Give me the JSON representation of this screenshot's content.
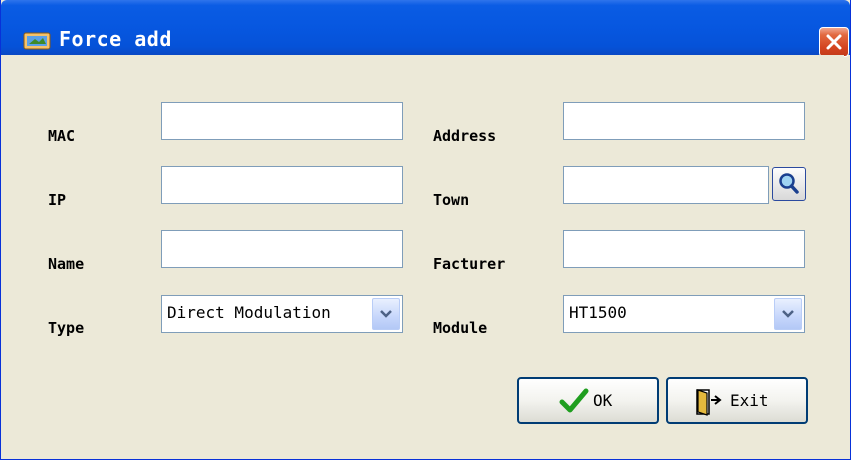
{
  "window": {
    "title": "Force add",
    "close_label": "Close"
  },
  "form": {
    "mac": {
      "label": "MAC",
      "value": ""
    },
    "ip": {
      "label": "IP",
      "value": ""
    },
    "name": {
      "label": "Name",
      "value": ""
    },
    "type": {
      "label": "Type",
      "selected": "Direct Modulation"
    },
    "address": {
      "label": "Address",
      "value": ""
    },
    "town": {
      "label": "Town",
      "value": ""
    },
    "facturer": {
      "label": "Facturer",
      "value": ""
    },
    "module": {
      "label": "Module",
      "selected": "HT1500"
    }
  },
  "buttons": {
    "ok_label": "OK",
    "exit_label": "Exit"
  },
  "icons": {
    "title": "app-window-icon",
    "close": "close-icon",
    "search": "magnifier-icon",
    "dropdown": "chevron-down-icon",
    "ok": "checkmark-icon",
    "exit": "exit-door-icon"
  },
  "colors": {
    "titlebar": "#0757e0",
    "close": "#d4441f",
    "panel": "#ece9d8",
    "ok_check": "#1f9e1f"
  }
}
